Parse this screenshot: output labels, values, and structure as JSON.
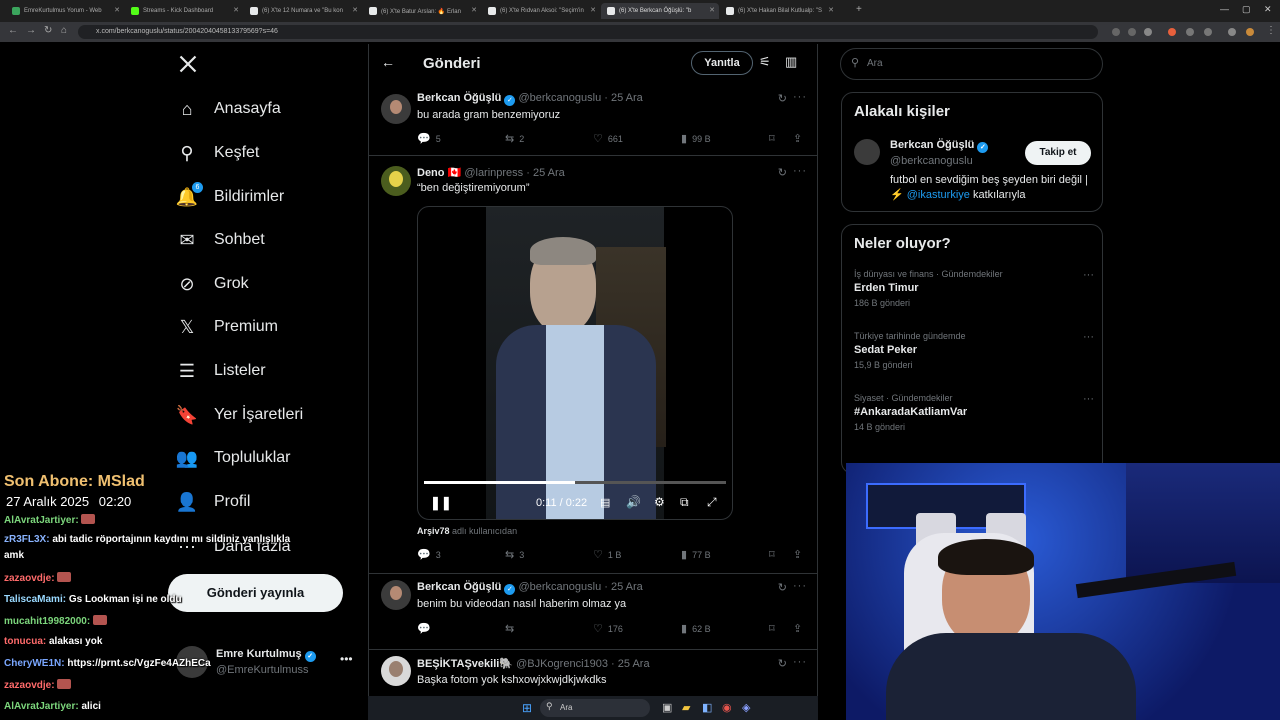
{
  "browser": {
    "tabs": [
      {
        "label": "EmreKurtulmus Yorum - Web",
        "color": "#3ba55d"
      },
      {
        "label": "Streams - Kick Dashboard",
        "color": "#53fc18"
      },
      {
        "label": "(6) X'te 12 Numara ve \"Bu kon",
        "color": "#e7e9ea"
      },
      {
        "label": "(6) X'te Batur Arslan: 🔥 Erlan",
        "color": "#e7e9ea"
      },
      {
        "label": "(6) X'te Rıdvan Aksoi: \"Seçim'in",
        "color": "#e7e9ea"
      },
      {
        "label": "(6) X'te Berkcan Öğüşlü: \"b",
        "color": "#e7e9ea"
      },
      {
        "label": "(6) X'te Hakan Bilal Kutlualp: \"S",
        "color": "#e7e9ea"
      }
    ],
    "url": "x.com/berkcanoguslu/status/2004204045813379569?s=46"
  },
  "sidebar": {
    "nav": [
      {
        "label": "Anasayfa",
        "icon": "home-icon",
        "glyph": "⌂"
      },
      {
        "label": "Keşfet",
        "icon": "search-icon",
        "glyph": "⚲"
      },
      {
        "label": "Bildirimler",
        "icon": "bell-icon",
        "glyph": "🔔",
        "badge": "6"
      },
      {
        "label": "Sohbet",
        "icon": "mail-icon",
        "glyph": "✉"
      },
      {
        "label": "Grok",
        "icon": "grok-icon",
        "glyph": "⊘"
      },
      {
        "label": "Premium",
        "icon": "x-logo-icon",
        "glyph": "𝕏"
      },
      {
        "label": "Listeler",
        "icon": "list-icon",
        "glyph": "☰"
      },
      {
        "label": "Yer İşaretleri",
        "icon": "bookmark-icon",
        "glyph": "🔖"
      },
      {
        "label": "Topluluklar",
        "icon": "communities-icon",
        "glyph": "👥"
      },
      {
        "label": "Profil",
        "icon": "profile-icon",
        "glyph": "👤"
      },
      {
        "label": "Daha fazla",
        "icon": "more-circle-icon",
        "glyph": "⋯"
      }
    ],
    "post_button": "Gönderi yayınla",
    "account": {
      "name": "Emre Kurtulmuş",
      "handle": "@EmreKurtulmuss"
    }
  },
  "main": {
    "title": "Gönderi",
    "reply_button": "Yanıtla",
    "posts": [
      {
        "name": "Berkcan Öğüşlü",
        "handle": "@berkcanoguslu",
        "date": "· 25 Ara",
        "text": "bu arada gram benzemiyoruz",
        "replies": "5",
        "reposts": "2",
        "likes": "661",
        "views": "99 B"
      },
      {
        "name": "Deno 🇨🇦",
        "handle": "@larinpress",
        "date": "· 25 Ara",
        "text": "“ben değiştiremiyorum”",
        "video": {
          "time": "0:11 / 0:22",
          "progress": 0.5,
          "credit_user": "Arşiv78",
          "credit_suffix": " adlı kullanıcıdan"
        },
        "replies": "3",
        "reposts": "3",
        "likes": "1 B",
        "views": "77 B"
      },
      {
        "name": "Berkcan Öğüşlü",
        "handle": "@berkcanoguslu",
        "date": "· 25 Ara",
        "text": "benim bu videodan nasıl haberim olmaz ya",
        "replies": "",
        "reposts": "",
        "likes": "176",
        "views": "62 B"
      },
      {
        "name": "BEŞİKTAŞvekili🐘",
        "handle": "@BJKogrenci1903",
        "date": "· 25 Ara",
        "text": "Başka fotom yok kshxowjxkwjdkjwkdks"
      }
    ]
  },
  "right": {
    "search_placeholder": "Ara",
    "relevant": {
      "title": "Alakalı kişiler",
      "name": "Berkcan Öğüşlü",
      "handle": "@berkcanoguslu",
      "follow": "Takip et",
      "bio_pre": "futbol en sevdiğim beş şeyden biri değil | ⚡",
      "bio_link": "@ikasturkiye",
      "bio_post": " katkılarıyla"
    },
    "trends": {
      "title": "Neler oluyor?",
      "items": [
        {
          "category": "İş dünyası ve finans · Gündemdekiler",
          "name": "Erden Timur",
          "count": "186 B gönderi"
        },
        {
          "category": "Türkiye tarihinde gündemde",
          "name": "Sedat Peker",
          "count": "15,9 B gönderi"
        },
        {
          "category": "Siyaset · Gündemdekiler",
          "name": "#AnkaradaKatliamVar",
          "count": "14 B gönderi"
        }
      ]
    }
  },
  "overlay": {
    "last_sub_label": "Son Abone: MSlad",
    "date": "27 Aralık 2025",
    "time": "02:20",
    "chat": [
      {
        "user": "AlAvratJartiyer:",
        "color": "#7cd67c",
        "msg": "",
        "emote": true
      },
      {
        "user": "zR3FL3X:",
        "color": "#8ab4ff",
        "msg": "abi tadic röportajının kaydını mı sildiniz yanlışlıkla"
      },
      {
        "user": "",
        "color": "#fff",
        "msg": "amk"
      },
      {
        "user": "zazaovdje:",
        "color": "#ff6b6b",
        "msg": "",
        "emote": true
      },
      {
        "user": "TaliscaMami:",
        "color": "#9ad9ff",
        "msg": "Gs Lookman işi ne oldu"
      },
      {
        "user": "mucahit19982000:",
        "color": "#7cd67c",
        "msg": "",
        "emote": true
      },
      {
        "user": "tonucua:",
        "color": "#ff6b6b",
        "msg": "alakası yok"
      },
      {
        "user": "CheryWE1N:",
        "color": "#7aa7ff",
        "msg": "https://prnt.sc/VgzFe4AZhECa"
      },
      {
        "user": "zazaovdje:",
        "color": "#ff6b6b",
        "msg": "",
        "emote": true
      },
      {
        "user": "AlAvratJartiyer:",
        "color": "#7cd67c",
        "msg": "alici"
      }
    ]
  },
  "taskbar": {
    "search": "Ara"
  }
}
